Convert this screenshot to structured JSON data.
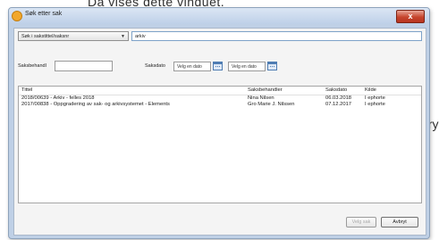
{
  "document": {
    "heading_fragment": "Da vises dette vinduet.",
    "right_fragment": "try"
  },
  "window": {
    "title": "Søk etter sak",
    "close_glyph": "x"
  },
  "search": {
    "field_selector": "Søk i sakstittel/saksnr",
    "query": "arkiv"
  },
  "filters": {
    "saksbehandler_label": "Saksbehandl",
    "saksdato_label": "Saksdato",
    "from_date_placeholder": "Velg en dato",
    "to_date_placeholder": "Velg en dato"
  },
  "results": {
    "columns": [
      "Tittel",
      "Saksbehandler",
      "Saksdato",
      "Kilde"
    ],
    "rows": [
      [
        "2018/00639 - Arkiv - felles 2018",
        "Nina Nilsen",
        "06.03.2018",
        "I ephorte"
      ],
      [
        "2017/00838 - Oppgradering av sak- og arkivsystemet - Elements",
        "Gro Marie J. Nilssen",
        "07.12.2017",
        "I ephorte"
      ]
    ]
  },
  "buttons": {
    "select": "Velg sak",
    "cancel": "Avbryt"
  }
}
